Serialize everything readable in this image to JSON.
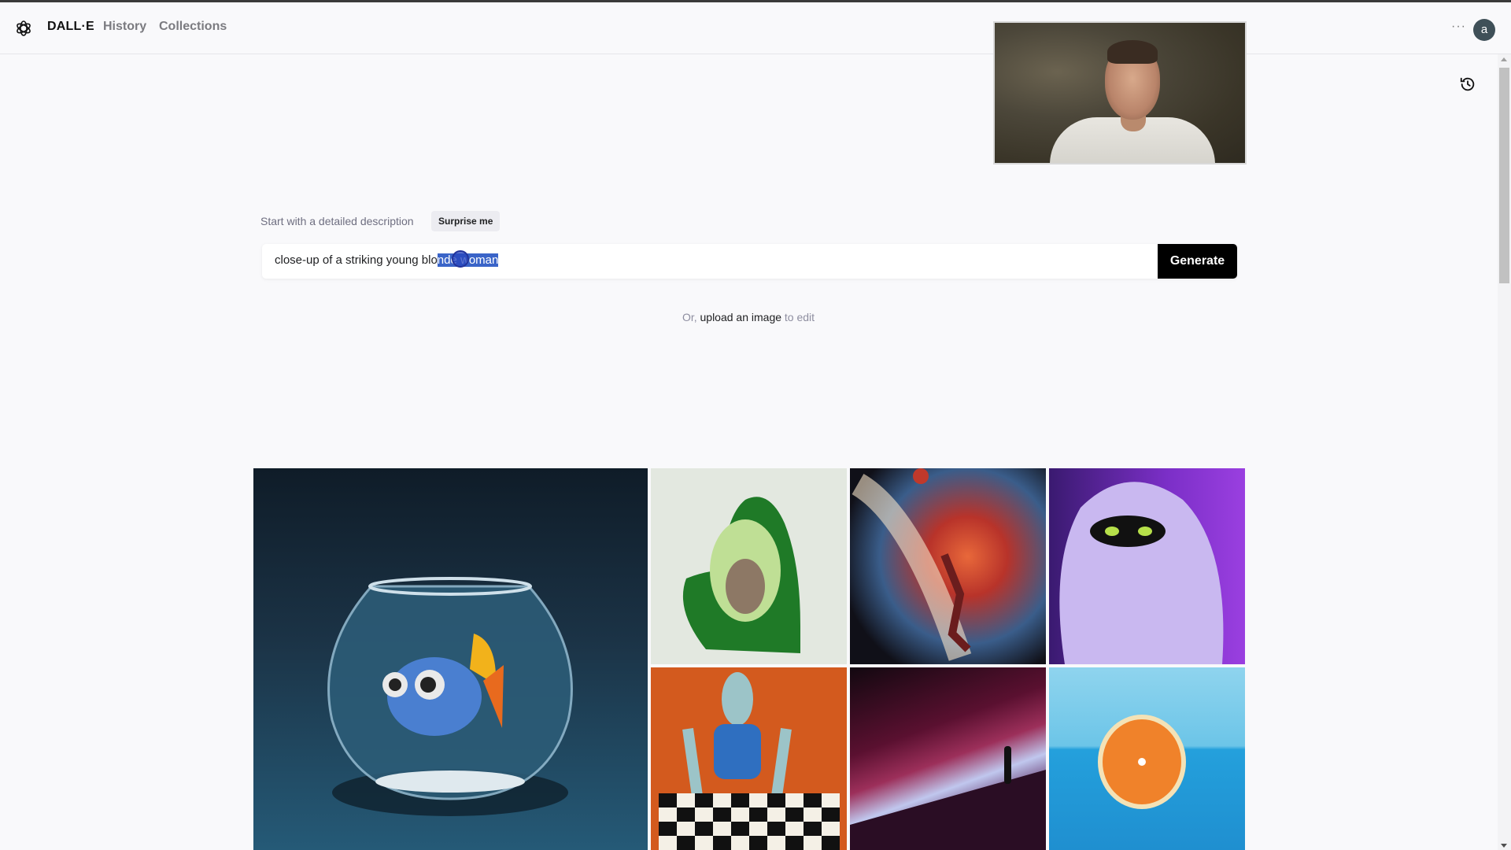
{
  "header": {
    "brand": "DALL·E",
    "nav": [
      {
        "label": "History"
      },
      {
        "label": "Collections"
      }
    ],
    "more_label": "···",
    "avatar_letter": "a"
  },
  "icons": {
    "logo": "openai-logo-icon",
    "history": "history-clock-icon"
  },
  "video_overlay": {
    "description": "webcam feed of presenter"
  },
  "prompt": {
    "label": "Start with a detailed description",
    "surprise_label": "Surprise me",
    "value_plain": "close-up of a striking young blo",
    "value_selected": "nde woman",
    "generate_label": "Generate"
  },
  "upload": {
    "prefix": "Or, ",
    "link": "upload an image",
    "suffix": " to edit"
  },
  "gallery": [
    {
      "subject": "3D render of a cartoon fish in a glass fishbowl"
    },
    {
      "subject": "armchair shaped like an avocado"
    },
    {
      "subject": "basketball player dunking in a cosmic nebula painting"
    },
    {
      "subject": "fluffy purple furry monster with green eyes"
    },
    {
      "subject": "robot playing chess, expressionist painting"
    },
    {
      "subject": "lone figure on a surreal dune landscape"
    },
    {
      "subject": "half orange on a blue background"
    }
  ],
  "colors": {
    "generate_bg": "#000000",
    "selection": "#3a64c8",
    "avatar_bg": "#3f5058"
  }
}
